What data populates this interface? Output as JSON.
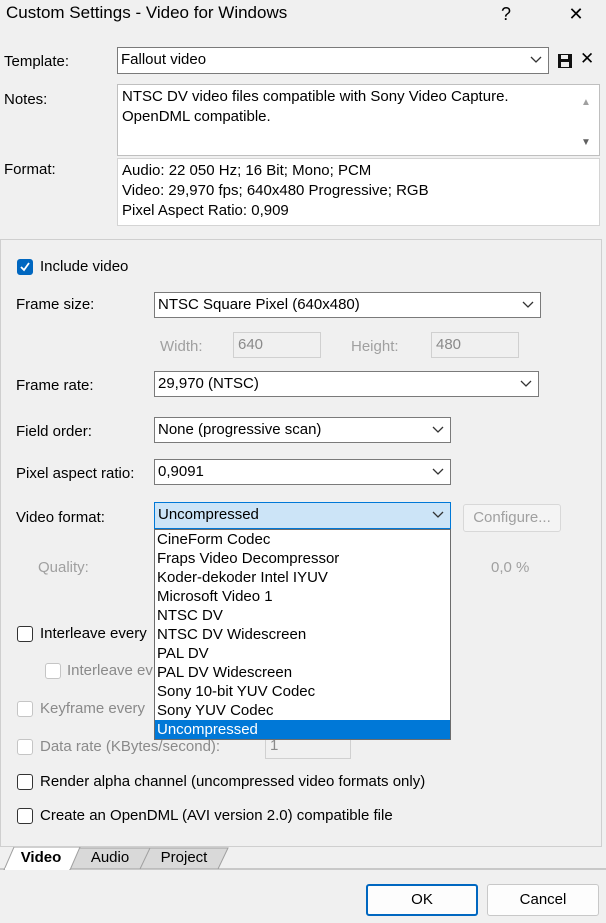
{
  "window": {
    "title": "Custom Settings - Video for Windows",
    "help_icon": "?",
    "close_icon": "✕"
  },
  "template": {
    "label": "Template:",
    "value": "Fallout video",
    "save_icon": "floppy-disk-icon",
    "delete_icon": "✕"
  },
  "notes": {
    "label": "Notes:",
    "lines": [
      "NTSC DV video files compatible with Sony Video Capture.",
      "OpenDML compatible."
    ]
  },
  "format": {
    "label": "Format:",
    "lines": [
      "Audio: 22 050 Hz; 16 Bit; Mono; PCM",
      "Video: 29,970 fps; 640x480 Progressive; RGB",
      "Pixel Aspect Ratio: 0,909"
    ]
  },
  "video": {
    "include_video": "Include video",
    "frame_size_label": "Frame size:",
    "frame_size_value": "NTSC Square Pixel (640x480)",
    "width_label": "Width:",
    "width_value": "640",
    "height_label": "Height:",
    "height_value": "480",
    "frame_rate_label": "Frame rate:",
    "frame_rate_value": "29,970 (NTSC)",
    "field_order_label": "Field order:",
    "field_order_value": "None (progressive scan)",
    "par_label": "Pixel aspect ratio:",
    "par_value": "0,9091",
    "video_format_label": "Video format:",
    "video_format_value": "Uncompressed",
    "configure_label": "Configure...",
    "quality_label": "Quality:",
    "quality_value": "0,0 %",
    "interleave_every": "Interleave every",
    "interleave_ev": "Interleave ev",
    "keyframe_every": "Keyframe every",
    "data_rate_label": "Data rate (KBytes/second):",
    "data_rate_value": "1",
    "render_alpha": "Render alpha channel (uncompressed video formats only)",
    "opendml": "Create an OpenDML (AVI version 2.0) compatible file"
  },
  "dropdown_items": [
    "CineForm Codec",
    "Fraps Video Decompressor",
    "Koder-dekoder Intel IYUV",
    "Microsoft Video 1",
    "NTSC DV",
    "NTSC DV Widescreen",
    "PAL DV",
    "PAL DV Widescreen",
    "Sony 10-bit YUV Codec",
    "Sony YUV Codec",
    "Uncompressed"
  ],
  "dropdown_selected_index": 10,
  "tabs": [
    "Video",
    "Audio",
    "Project"
  ],
  "buttons": {
    "ok": "OK",
    "cancel": "Cancel"
  },
  "colors": {
    "accent": "#0078d7",
    "checkbox": "#0067c0"
  }
}
